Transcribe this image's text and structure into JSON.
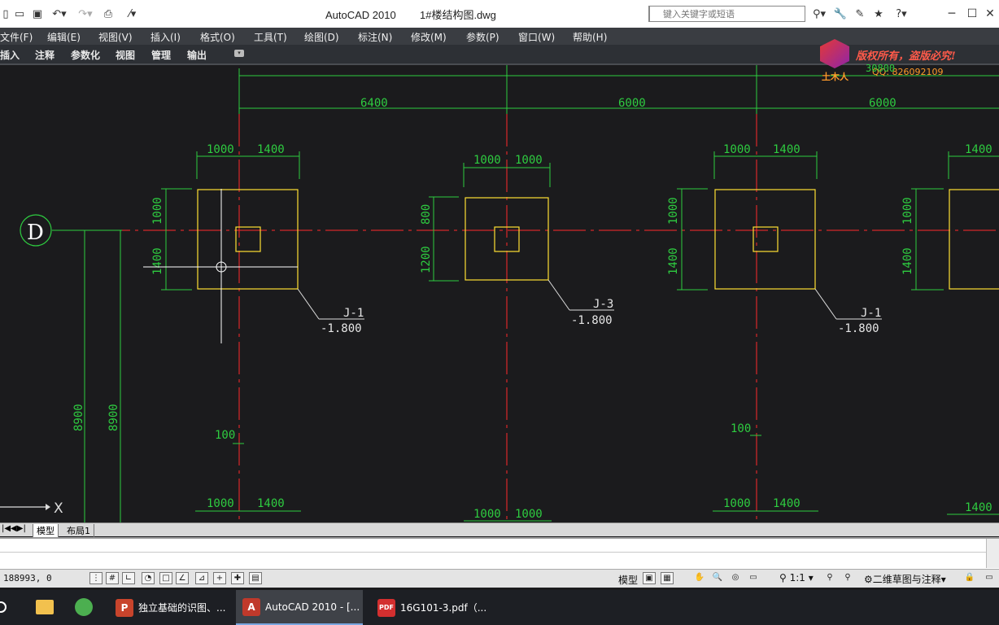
{
  "titlebar": {
    "app_name": "AutoCAD 2010",
    "file_name": "1#楼结构图.dwg",
    "search_placeholder": "键入关键字或短语",
    "minimize": "─",
    "maximize": "☐",
    "close": "✕"
  },
  "menu": [
    "文件(F)",
    "编辑(E)",
    "视图(V)",
    "插入(I)",
    "格式(O)",
    "工具(T)",
    "绘图(D)",
    "标注(N)",
    "修改(M)",
    "参数(P)",
    "窗口(W)",
    "帮助(H)"
  ],
  "ribbon_tabs": [
    "插入",
    "注释",
    "参数化",
    "视图",
    "管理",
    "输出"
  ],
  "watermark": {
    "copyright": "版权所有，盗版必究!",
    "logo_text": "土木人",
    "qq": "QQ: 826092109"
  },
  "drawing": {
    "overall_dim": "30800",
    "bay_dims": [
      "6400",
      "6000",
      "6000"
    ],
    "axis_label": "D",
    "footings": [
      {
        "left": "1000",
        "right": "1400",
        "top": "1000",
        "bottom": "1400",
        "tag": "J-1",
        "elev": "-1.800"
      },
      {
        "left": "1000",
        "right": "1000",
        "top": "800",
        "bottom": "1200",
        "tag": "J-3",
        "elev": "-1.800"
      },
      {
        "left": "1000",
        "right": "1400",
        "top": "1000",
        "bottom": "1400",
        "tag": "J-1",
        "elev": "-1.800"
      },
      {
        "right": "1400",
        "top": "1000",
        "bottom": "1400"
      }
    ],
    "bottom_dims": [
      "1000",
      "1400",
      "1000",
      "1000",
      "1000",
      "1400",
      "1400"
    ],
    "vert_dims": [
      "8900",
      "8900"
    ],
    "small_dims": [
      "100",
      "100"
    ],
    "ucs_label": "X"
  },
  "layout_tabs": [
    "模型",
    "布局1"
  ],
  "status": {
    "coords": "188993, 0",
    "model_label": "模型",
    "scale": "1:1",
    "workspace": "二维草图与注释"
  },
  "taskbar": [
    {
      "label": "独立基础的识图、...",
      "color": "#c8442c",
      "glyph": "P"
    },
    {
      "label": "AutoCAD 2010 - [...",
      "color": "#c0392b",
      "glyph": "A"
    },
    {
      "label": "16G101-3.pdf（...",
      "color": "#d32f2f",
      "glyph": "PDF"
    }
  ],
  "colors": {
    "dim_green": "#2ecc40",
    "axis_red": "#ff2a2a",
    "footing_yellow": "#ffe033",
    "label_white": "#dddddd"
  }
}
